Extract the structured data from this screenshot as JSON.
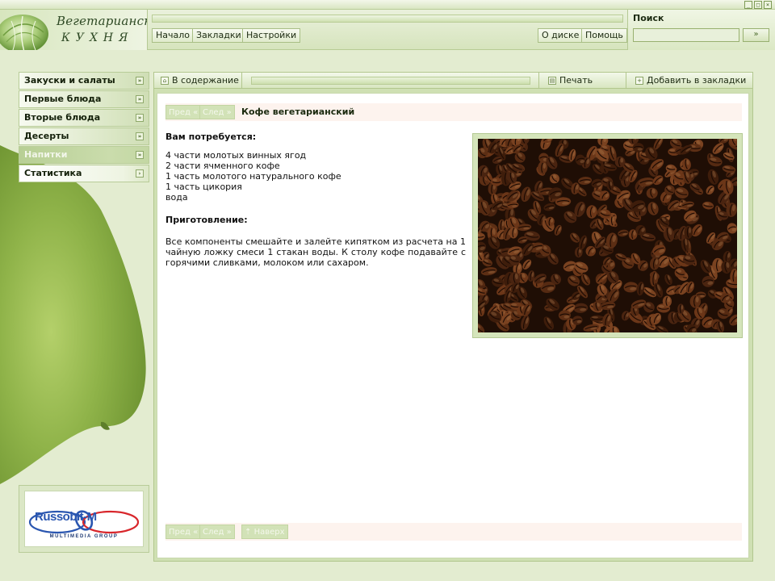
{
  "logo": {
    "line1": "Вегетарианская",
    "line2": "КУХНЯ"
  },
  "topnav": {
    "start": "Начало",
    "bookmarks": "Закладки",
    "settings": "Настройки",
    "about": "О диске",
    "help": "Помощь"
  },
  "search": {
    "title": "Поиск",
    "value": "",
    "go_label": "»"
  },
  "window_controls": [
    "_",
    "□",
    "×"
  ],
  "sidebar": {
    "items": [
      {
        "label": "Закуски и салаты"
      },
      {
        "label": "Первые блюда"
      },
      {
        "label": "Вторые блюда"
      },
      {
        "label": "Десерты"
      },
      {
        "label": "Напитки"
      },
      {
        "label": "Статистика"
      }
    ]
  },
  "brand": {
    "name": "Russobit-M",
    "tagline": "MULTIMEDIA GROUP"
  },
  "toolbar": {
    "contents": "В содержание",
    "print": "Печать",
    "add_bookmark": "Добавить в закладки"
  },
  "recipe": {
    "prev": "Пред",
    "next": "След",
    "up": "Наверх",
    "title": "Кофе вегетарианский",
    "needs_title": "Вам потребуется:",
    "ingredients": [
      "4 части молотых винных ягод",
      "2 части ячменного кофе",
      "1 часть молотого натурального кофе",
      "1 часть цикория",
      "вода"
    ],
    "prep_title": "Приготовление:",
    "prep_text": "Все компоненты смешайте и залейте кипятком из расчета на 1 чайную ложку смеси 1 стакан воды. К столу кофе подавайте с горячими сливками, молоком или сахаром."
  },
  "colors": {
    "background": "#e3ecd0",
    "panel": "#cfe0b3",
    "accent_green": "#8db04a",
    "nav_row": "#fdf3ee"
  }
}
